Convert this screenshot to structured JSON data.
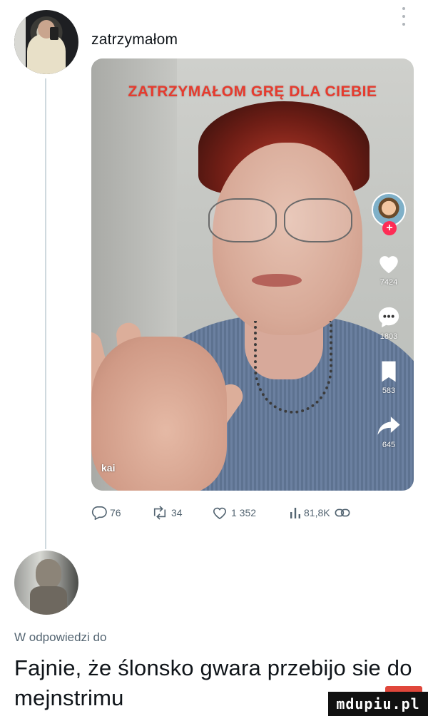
{
  "tweet": {
    "username": "zatrzymałom",
    "media": {
      "overlay_text": "ZATRZYMAŁOM GRĘ DLA CIEBIE",
      "caption_user": "kai",
      "side_rail": {
        "likes": "7424",
        "comments": "1803",
        "saves": "583",
        "shares": "645"
      }
    },
    "actions": {
      "replies": "76",
      "retweets": "34",
      "likes": "1 352",
      "views": "81,8K"
    }
  },
  "reply": {
    "reply_to_label": "W odpowiedzi do",
    "text": "Fajnie, że ślonsko gwara przebijo sie do mejnstrimu"
  },
  "watermark": "mdupiu.pl",
  "colors": {
    "accent_red": "#fe2c55",
    "muted": "#536471",
    "thread_line": "#cfd9de"
  },
  "icons": [
    "more-icon",
    "heart-icon",
    "comment-icon",
    "bookmark-icon",
    "share-icon",
    "reply-icon",
    "retweet-icon",
    "like-icon",
    "views-icon",
    "share-link-icon",
    "plus-icon"
  ]
}
